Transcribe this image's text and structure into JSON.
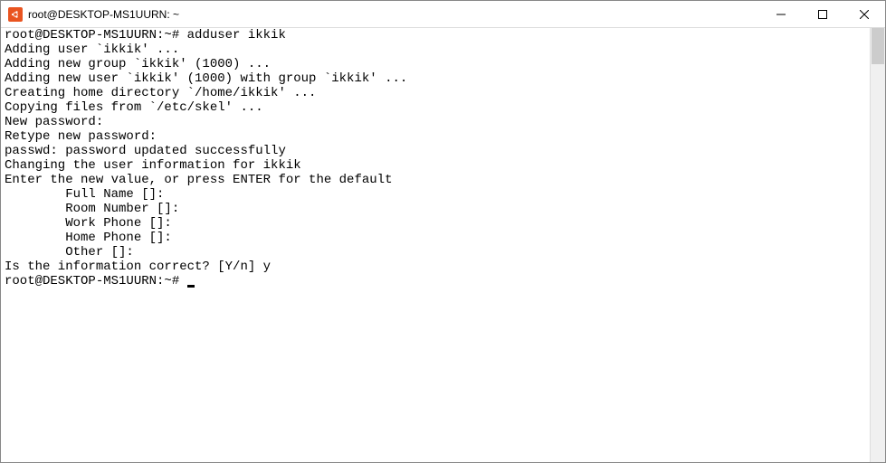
{
  "window": {
    "title": "root@DESKTOP-MS1UURN: ~"
  },
  "terminal": {
    "prompt1": "root@DESKTOP-MS1UURN:~#",
    "command1": " adduser ikkik",
    "lines": [
      "Adding user `ikkik' ...",
      "Adding new group `ikkik' (1000) ...",
      "Adding new user `ikkik' (1000) with group `ikkik' ...",
      "Creating home directory `/home/ikkik' ...",
      "Copying files from `/etc/skel' ...",
      "New password:",
      "Retype new password:",
      "passwd: password updated successfully",
      "Changing the user information for ikkik",
      "Enter the new value, or press ENTER for the default",
      "        Full Name []:",
      "        Room Number []:",
      "        Work Phone []:",
      "        Home Phone []:",
      "        Other []:",
      "Is the information correct? [Y/n] y"
    ],
    "prompt2": "root@DESKTOP-MS1UURN:~# "
  }
}
